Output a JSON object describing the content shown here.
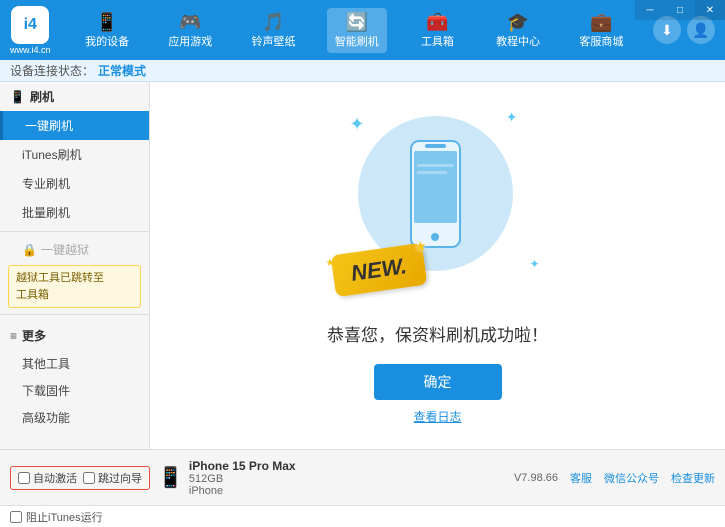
{
  "app": {
    "logo_text": "www.i4.cn",
    "logo_letter": "i4",
    "window_controls": [
      "─",
      "□",
      "✕"
    ]
  },
  "nav": {
    "items": [
      {
        "id": "my-device",
        "label": "我的设备",
        "icon": "📱"
      },
      {
        "id": "app-games",
        "label": "应用游戏",
        "icon": "👤"
      },
      {
        "id": "ringtone",
        "label": "铃声壁纸",
        "icon": "🔔"
      },
      {
        "id": "smart-flash",
        "label": "智能刷机",
        "icon": "🔄",
        "active": true
      },
      {
        "id": "toolbox",
        "label": "工具箱",
        "icon": "🧰"
      },
      {
        "id": "tutorial",
        "label": "教程中心",
        "icon": "🎓"
      },
      {
        "id": "service",
        "label": "客服商城",
        "icon": "💬"
      }
    ],
    "download_icon": "⬇",
    "user_icon": "👤"
  },
  "mode_bar": {
    "label": "设备连接状态：",
    "status": "正常模式"
  },
  "sidebar": {
    "section1": {
      "icon": "📱",
      "label": "刷机",
      "items": [
        {
          "id": "one-key-flash",
          "label": "一键刷机",
          "active": true
        },
        {
          "id": "itunes-flash",
          "label": "iTunes刷机"
        },
        {
          "id": "pro-flash",
          "label": "专业刷机"
        },
        {
          "id": "batch-flash",
          "label": "批量刷机"
        }
      ]
    },
    "disabled_item": "一键越狱",
    "disabled_notice": "越狱工具已跳转至\n工具箱",
    "section2": {
      "label": "更多",
      "items": [
        {
          "id": "other-tools",
          "label": "其他工具"
        },
        {
          "id": "download-fw",
          "label": "下载固件"
        },
        {
          "id": "advanced",
          "label": "高级功能"
        }
      ]
    }
  },
  "content": {
    "success_msg": "恭喜您，保资料刷机成功啦！",
    "confirm_btn": "确定",
    "view_log": "查看日志",
    "new_badge": "NEW."
  },
  "bottom": {
    "auto_activate": "自动激活",
    "guide_activate": "跳过向导",
    "device_name": "iPhone 15 Pro Max",
    "device_storage": "512GB",
    "device_type": "iPhone",
    "version": "V7.98.66",
    "skin_label": "客服",
    "wechat_label": "微信公众号",
    "check_update": "检查更新",
    "itunes_label": "阻止iTunes运行"
  }
}
